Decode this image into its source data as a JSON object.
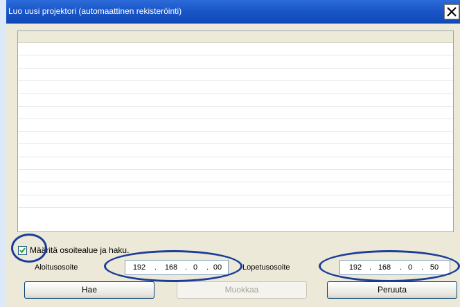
{
  "window": {
    "title": "Luo uusi projektori (automaattinen rekisteröinti)",
    "close_glyph": "✕"
  },
  "list": {
    "rows": 13
  },
  "search": {
    "checkbox_label": "Määritä osoitealue ja haku.",
    "checkbox_checked": true,
    "start_label": "Aloitusosoite",
    "end_label": "Lopetusosoite",
    "start_ip": [
      "192",
      "168",
      "0",
      "00"
    ],
    "end_ip": [
      "192",
      "168",
      "0",
      "50"
    ]
  },
  "buttons": {
    "search": "Hae",
    "edit": "Muokkaa",
    "cancel": "Peruuta"
  },
  "highlight_color": "#1b3d9a"
}
